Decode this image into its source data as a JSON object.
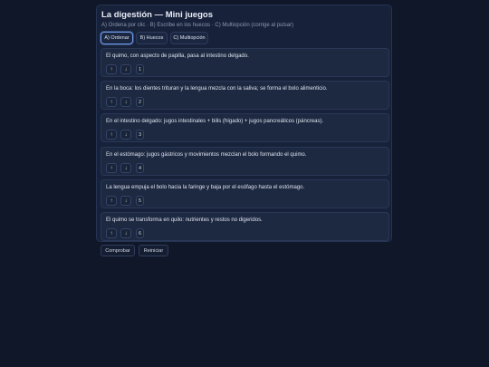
{
  "header": {
    "title": "La digestión — Mini juegos",
    "subtitle": "A) Ordena por clic · B) Escribe en los huecos · C) Multiopción (corrige al pulsar)"
  },
  "tabs": [
    {
      "label": "A) Ordenar",
      "active": true
    },
    {
      "label": "B) Huecos",
      "active": false
    },
    {
      "label": "C) Multiopción",
      "active": false
    }
  ],
  "controls": {
    "up_icon": "↑",
    "down_icon": "↓"
  },
  "items": [
    {
      "text": "El quimo, con aspecto de papilla, pasa al intestino delgado.",
      "position": "1"
    },
    {
      "text": "En la boca: los dientes trituran y la lengua mezcla con la saliva; se forma el bolo alimenticio.",
      "position": "2"
    },
    {
      "text": "En el intestino delgado: jugos intestinales + bilis (hígado) + jugos pancreáticos (páncreas).",
      "position": "3"
    },
    {
      "text": "En el estómago: jugos gástricos y movimientos mezclan el bolo formando el quimo.",
      "position": "4"
    },
    {
      "text": "La lengua empuja el bolo hacia la faringe y baja por el esófago hasta el estómago.",
      "position": "5"
    },
    {
      "text": "El quimo se transforma en quilo: nutrientes y restos no digeridos.",
      "position": "6"
    }
  ],
  "actions": {
    "check_label": "Comprobar",
    "reset_label": "Reiniciar"
  },
  "colors": {
    "background": "#0f1729",
    "card": "#17213a",
    "active_tab_border": "#6f9ae8"
  }
}
